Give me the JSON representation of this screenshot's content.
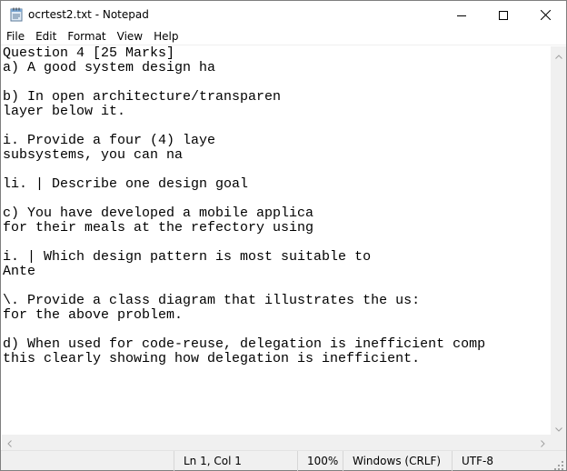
{
  "window": {
    "title": "ocrtest2.txt - Notepad"
  },
  "icons": {
    "app": "notepad-icon",
    "minimize": "minimize-icon",
    "maximize": "maximize-icon",
    "close": "close-icon"
  },
  "menu": {
    "items": [
      "File",
      "Edit",
      "Format",
      "View",
      "Help"
    ]
  },
  "document": {
    "lines": [
      "Question 4 [25 Marks]",
      "a) A good system design ha",
      "",
      "b) In open architecture/transparen",
      "layer below it.",
      "",
      "i. Provide a four (4) laye",
      "subsystems, you can na",
      "",
      "li. | Describe one design goal",
      "",
      "c) You have developed a mobile applica",
      "for their meals at the refectory using",
      "",
      "i. | Which design pattern is most suitable to",
      "Ante",
      "",
      "\\. Provide a class diagram that illustrates the us:",
      "for the above problem.",
      "",
      "d) When used for code-reuse, delegation is inefficient comp",
      "this clearly showing how delegation is inefficient."
    ]
  },
  "statusbar": {
    "position": "Ln 1, Col 1",
    "zoom": "100%",
    "line_ending": "Windows (CRLF)",
    "encoding": "UTF-8"
  }
}
